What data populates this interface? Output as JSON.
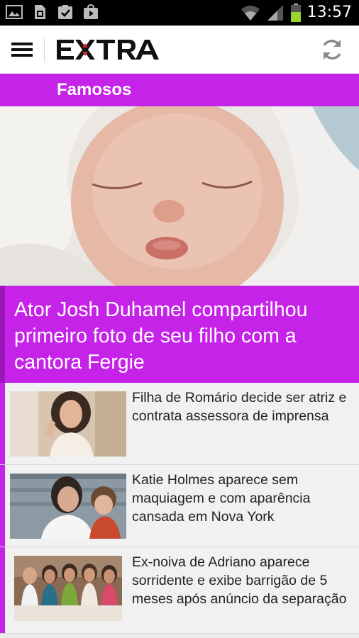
{
  "status_bar": {
    "time": "13:57",
    "icons": [
      "gallery-icon",
      "sim-card-icon",
      "download-done-icon",
      "play-store-icon",
      "wifi-icon",
      "signal-icon",
      "battery-icon"
    ]
  },
  "app_bar": {
    "logo_text": "EXTRA",
    "menu_icon": "hamburger-menu-icon",
    "refresh_icon": "refresh-icon"
  },
  "section": {
    "title": "Famosos",
    "accent_color": "#c623e8"
  },
  "hero": {
    "headline": "Ator Josh Duhamel compartilhou primeiro foto de seu filho com a cantora Fergie"
  },
  "news": [
    {
      "title": "Filha de Romário decide ser atriz e contrata assessora de imprensa"
    },
    {
      "title": "Katie Holmes aparece sem maquiagem e com aparência cansada em Nova York"
    },
    {
      "title": "Ex-noiva de Adriano aparece sorridente e exibe barrigão de 5 meses após anúncio da separação"
    }
  ]
}
